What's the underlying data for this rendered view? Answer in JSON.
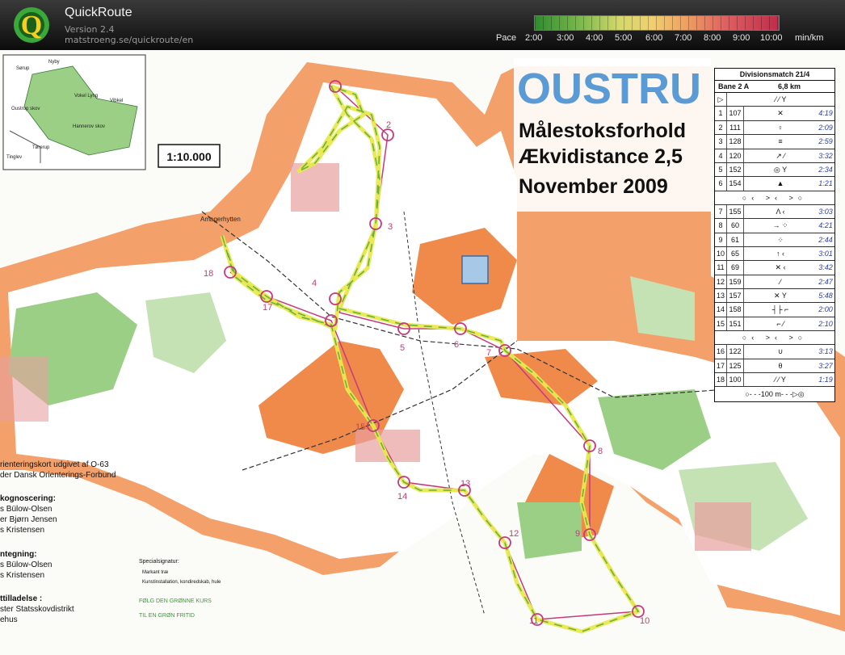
{
  "app": {
    "title": "QuickRoute",
    "version": "Version 2.4",
    "url": "matstroeng.se/quickroute/en"
  },
  "pace_legend": {
    "label": "Pace",
    "ticks": [
      "2:00",
      "3:00",
      "4:00",
      "5:00",
      "6:00",
      "7:00",
      "8:00",
      "9:00",
      "10:00"
    ],
    "unit": "min/km"
  },
  "map": {
    "title": "OUSTRU",
    "subtitle_lines": [
      "Målestoksforhold",
      "Ækvidistance 2,5",
      "November 2009"
    ],
    "scale": "1:10.000",
    "place_label": "Amagerhytten",
    "overview_places": [
      "Sørup",
      "Nyby",
      "Oustrup skov",
      "Vokel Lyng",
      "Hannerov skov",
      "Tinglev",
      "Tørerup",
      "Vibkel"
    ],
    "controls": [
      "1",
      "2",
      "3",
      "4",
      "5",
      "6",
      "7",
      "8",
      "9",
      "10",
      "11",
      "12",
      "13",
      "14",
      "15",
      "16",
      "17",
      "18"
    ],
    "credits": [
      "rienteringskort udgivet af O-63",
      "der Dansk Orienterings-Forbund",
      "kognoscering:",
      "s Bülow-Olsen",
      "er Bjørn Jensen",
      "s Kristensen",
      "ntegning:",
      "s Bülow-Olsen",
      "s Kristensen",
      "ttilladelse :",
      "ster Statsskovdistrikt",
      "ehus"
    ],
    "special_signs": {
      "heading": "Specialsignatur:",
      "items": [
        "Markant træ",
        "Kunstinstallation, kondiredskab, hule"
      ],
      "green_lines": [
        "FØLG DEN GRØNNE KURS",
        "TIL EN GRØN FRITID"
      ]
    }
  },
  "description_sheet": {
    "title": "Divisionsmatch 21/4",
    "course": "Bane 2 A",
    "length": "6,8 km",
    "rows": [
      {
        "n": "1",
        "code": "107",
        "note": "4:19"
      },
      {
        "n": "2",
        "code": "111",
        "note": "2:09"
      },
      {
        "n": "3",
        "code": "128",
        "note": "2:59"
      },
      {
        "n": "4",
        "code": "120",
        "note": "3:32"
      },
      {
        "n": "5",
        "code": "152",
        "note": "2:34"
      },
      {
        "n": "6",
        "code": "154",
        "note": "1:21"
      },
      {
        "n": "7",
        "code": "155",
        "note": "3:03"
      },
      {
        "n": "8",
        "code": "60",
        "note": "4:21"
      },
      {
        "n": "9",
        "code": "61",
        "note": "2:44"
      },
      {
        "n": "10",
        "code": "65",
        "note": "3:01"
      },
      {
        "n": "11",
        "code": "69",
        "note": "3:42"
      },
      {
        "n": "12",
        "code": "159",
        "note": "2:47"
      },
      {
        "n": "13",
        "code": "157",
        "note": "5:48"
      },
      {
        "n": "14",
        "code": "158",
        "note": "2:00"
      },
      {
        "n": "15",
        "code": "151",
        "note": "2:10"
      },
      {
        "n": "16",
        "code": "122",
        "note": "3:13"
      },
      {
        "n": "17",
        "code": "125",
        "note": "3:27"
      },
      {
        "n": "18",
        "code": "100",
        "note": "1:19"
      }
    ],
    "finish": "100 m"
  },
  "colors": {
    "header": "#1a1a1a",
    "map_orange": "#f08a4b",
    "map_green": "#9ccf86",
    "course_magenta": "#c6397c",
    "route_yellow": "#e7e94d",
    "route_green": "#6bb043"
  }
}
